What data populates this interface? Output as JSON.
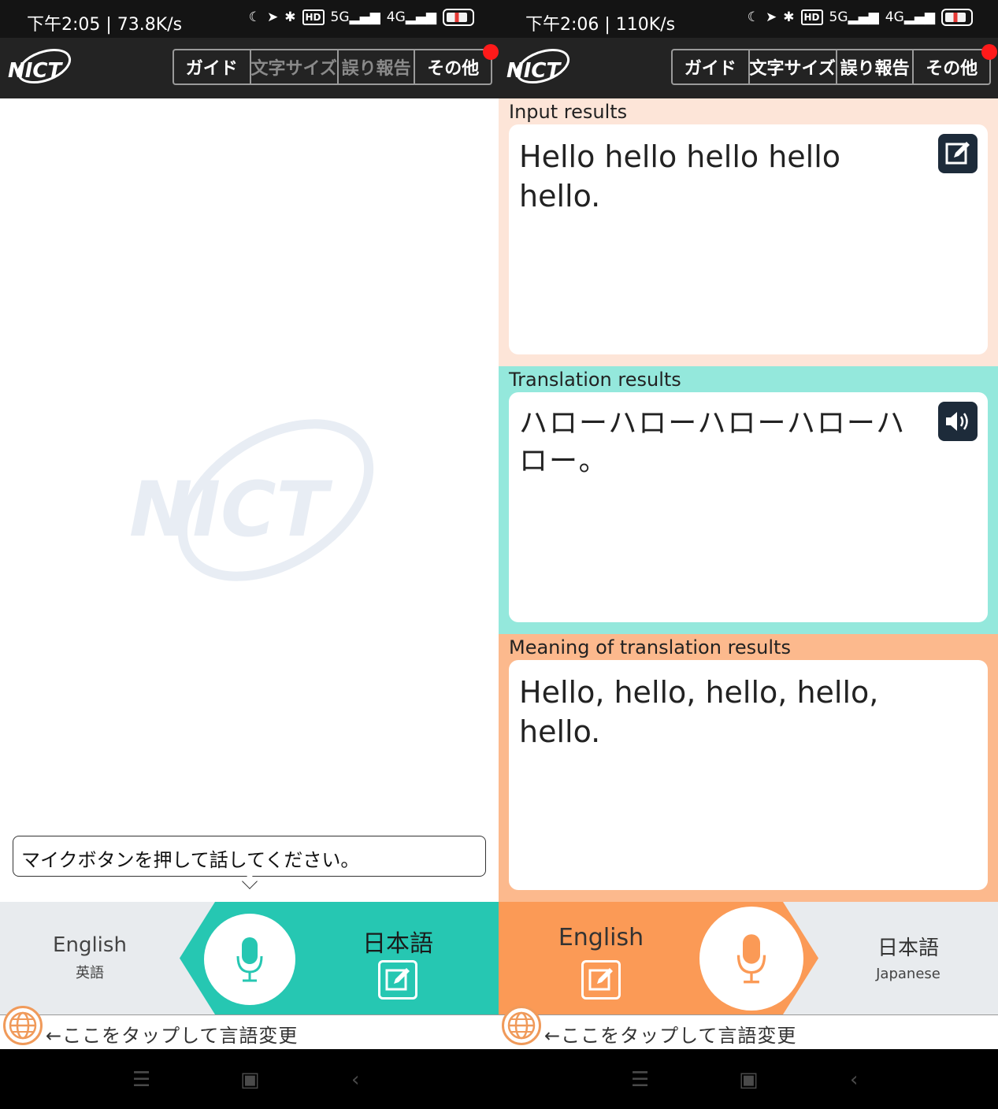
{
  "status_left": {
    "time_speed": "下午2:05 | 73.8K/s"
  },
  "status_right": {
    "time_speed": "下午2:06 | 110K/s"
  },
  "status_common": {
    "hd": "HD",
    "net5g": "5G",
    "net4g": "4G",
    "battery": "76"
  },
  "header": {
    "logo_text": "NICT",
    "menu": {
      "guide": "ガイド",
      "text_size": "文字サイズ",
      "error_report": "誤り報告",
      "other": "その他"
    }
  },
  "left": {
    "watermark": "NICT",
    "hint": "マイクボタンを押して話してください。",
    "source_lang": {
      "name": "English",
      "sub": "英語"
    },
    "target_lang": {
      "name": "日本語"
    }
  },
  "right": {
    "input_label": "Input results",
    "input_text": "Hello hello hello hello hello.",
    "translation_label": "Translation results",
    "translation_text": "ハローハローハローハローハロー。",
    "meaning_label": "Meaning of translation results",
    "meaning_text": "Hello, hello, hello, hello, hello.",
    "source_lang": {
      "name": "English"
    },
    "target_lang": {
      "name": "日本語",
      "sub": "Japanese"
    }
  },
  "lang_tip": "←ここをタップして言語変更",
  "colors": {
    "teal": "#26c7b2",
    "orange": "#fb9a56",
    "input_bg": "#fde5d8",
    "translation_bg": "#94e8dc",
    "meaning_bg": "#fcb98d",
    "header_bg": "#232323"
  },
  "icons": [
    "microphone-icon",
    "edit-icon",
    "speaker-icon",
    "globe-icon",
    "menu-icon",
    "home-icon",
    "back-icon"
  ]
}
